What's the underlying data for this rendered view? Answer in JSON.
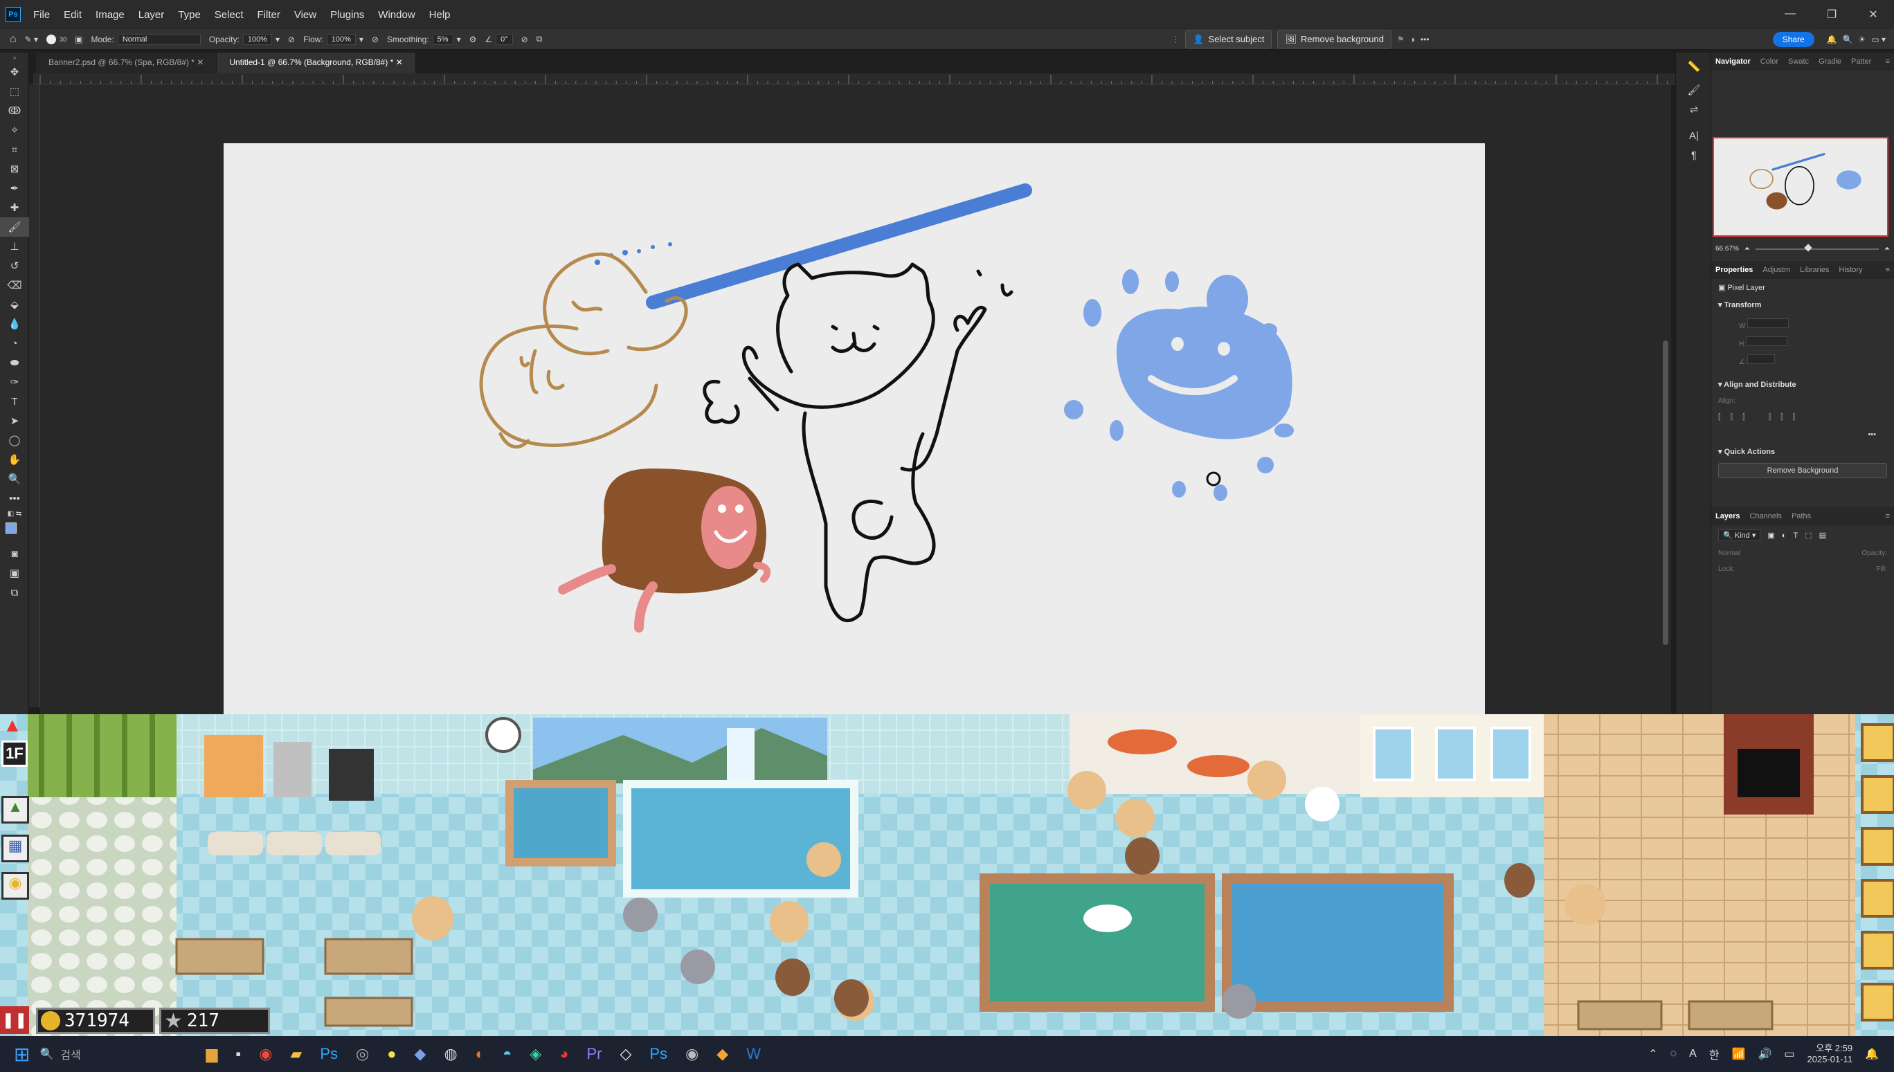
{
  "menubar": {
    "logo": "Ps",
    "items": [
      "File",
      "Edit",
      "Image",
      "Layer",
      "Type",
      "Select",
      "Filter",
      "View",
      "Plugins",
      "Window",
      "Help"
    ]
  },
  "options": {
    "brush_size": "30",
    "mode_label": "Mode:",
    "mode_value": "Normal",
    "opacity_label": "Opacity:",
    "opacity_value": "100%",
    "flow_label": "Flow:",
    "flow_value": "100%",
    "smoothing_label": "Smoothing:",
    "smoothing_value": "5%",
    "angle_value": "0°",
    "select_subject": "Select subject",
    "remove_background": "Remove background",
    "share": "Share"
  },
  "tabs": [
    {
      "label": "Banner2.psd @ 66.7% (Spa, RGB/8#) *"
    },
    {
      "label": "Untitled-1 @ 66.7% (Background, RGB/8#) *"
    }
  ],
  "right_panel": {
    "top_tabs": [
      "Navigator",
      "Color",
      "Swatc",
      "Gradie",
      "Patter"
    ],
    "zoom": "66.67%",
    "prop_tabs": [
      "Properties",
      "Adjustm",
      "Libraries",
      "History"
    ],
    "pixel_layer": "Pixel Layer",
    "transform": "Transform",
    "w_label": "W",
    "h_label": "H",
    "align_distribute": "Align and Distribute",
    "align_label": "Align:",
    "quick_actions": "Quick Actions",
    "remove_bg_btn": "Remove Background",
    "layer_tabs": [
      "Layers",
      "Channels",
      "Paths"
    ],
    "kind": "Kind",
    "blend": "Normal",
    "opacity": "Opacity:",
    "lock": "Lock:",
    "fill": "Fill:"
  },
  "game": {
    "floor": "1F",
    "coins": "371974",
    "stars": "217"
  },
  "taskbar": {
    "search_placeholder": "검색",
    "time": "오후 2:59",
    "date": "2025-01-11"
  },
  "colors": {
    "accent": "#1473e6",
    "blue_paint": "#4a7ed4",
    "light_blue": "#7fa6e6",
    "brown_line": "#b58a4e",
    "brown_fill": "#8a522b",
    "pink": "#e88a8a"
  }
}
